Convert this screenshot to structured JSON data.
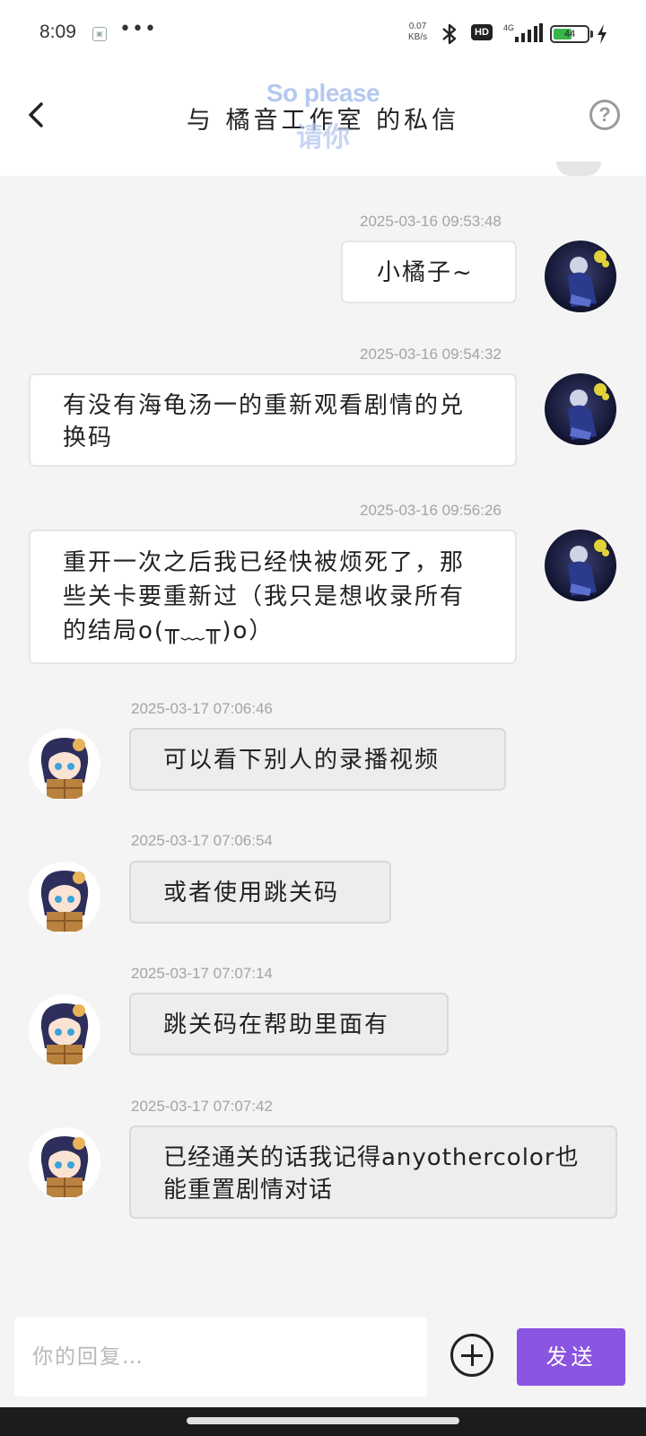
{
  "status_bar": {
    "time": "8:09",
    "more": "•••",
    "net_speed_value": "0.07",
    "net_speed_unit": "KB/s",
    "hd": "HD",
    "network": "4G",
    "battery": "44"
  },
  "header": {
    "title": "与 橘音工作室 的私信",
    "watermark_top": "So please",
    "watermark_bottom": "请你",
    "help": "?"
  },
  "messages": [
    {
      "time": "2025-03-16 09:53:48",
      "text": "小橘子~"
    },
    {
      "time": "2025-03-16 09:54:32",
      "text": "有没有海龟汤一的重新观看剧情的兑换码"
    },
    {
      "time": "2025-03-16 09:56:26",
      "text": "重开一次之后我已经快被烦死了，那些关卡要重新过（我只是想收录所有的结局o(╥﹏╥)o）"
    },
    {
      "time": "2025-03-17 07:06:46",
      "text": "可以看下别人的录播视频"
    },
    {
      "time": "2025-03-17 07:06:54",
      "text": "或者使用跳关码"
    },
    {
      "time": "2025-03-17 07:07:14",
      "text": "跳关码在帮助里面有"
    },
    {
      "time": "2025-03-17 07:07:42",
      "text": "已经通关的话我记得anyothercolor也能重置剧情对话"
    }
  ],
  "input": {
    "placeholder": "你的回复…",
    "send_label": "发送"
  },
  "colors": {
    "accent": "#8a55e0",
    "watermark": "#b5c8ef",
    "battery_green": "#39b54a"
  }
}
